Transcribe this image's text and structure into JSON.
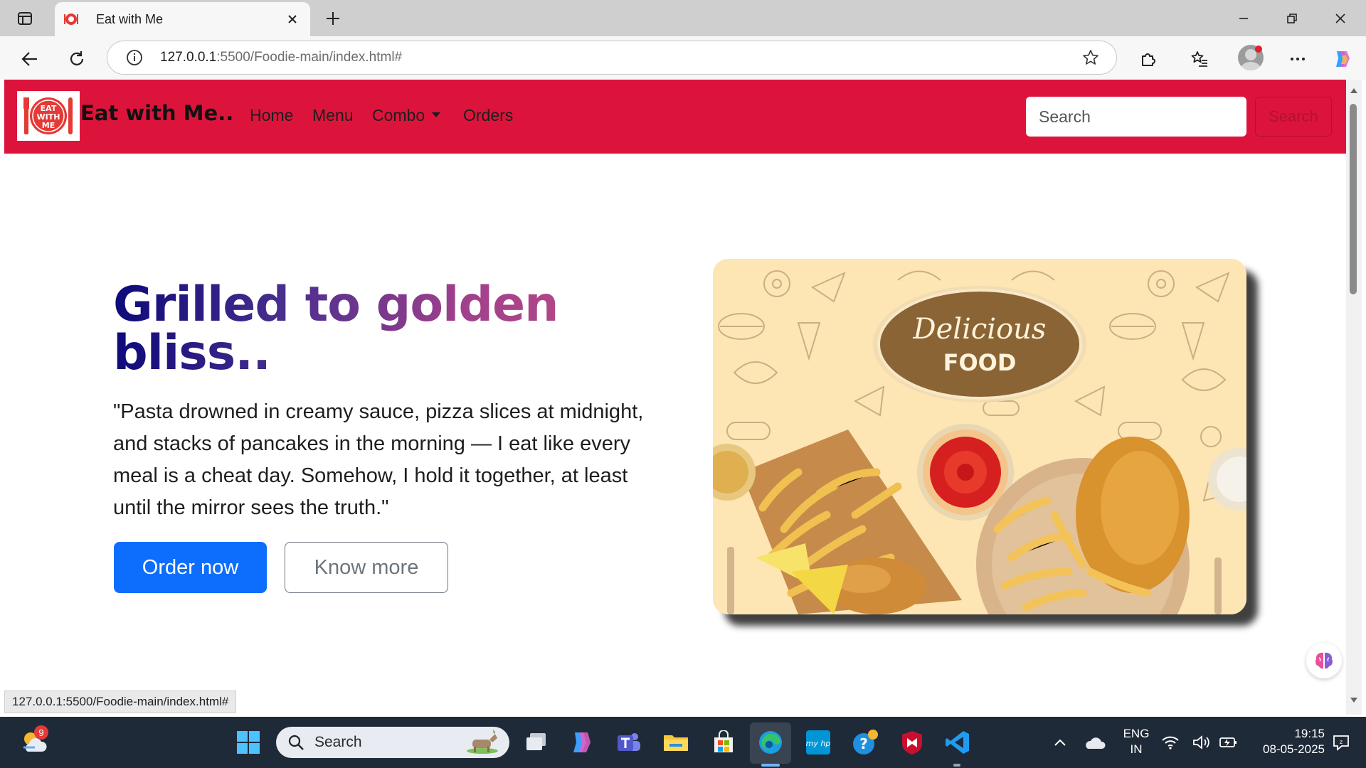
{
  "browser": {
    "tab_title": "Eat with Me",
    "url_host": "127.0.0.1",
    "url_path": ":5500/Foodie-main/index.html#",
    "status_url": "127.0.0.1:5500/Foodie-main/index.html#"
  },
  "navbar": {
    "brand": "Eat with Me..",
    "logo_text": [
      "EAT",
      "WITH",
      "ME"
    ],
    "links": [
      "Home",
      "Menu",
      "Combo",
      "Orders"
    ],
    "search_placeholder": "Search",
    "search_button": "Search",
    "colors": {
      "navbar_bg": "#dc143c",
      "primary": "#0d6efd"
    }
  },
  "hero": {
    "title": "Grilled to golden bliss..",
    "text": "\"Pasta drowned in creamy sauce, pizza slices at midnight, and stacks of pancakes in the morning — I eat like every meal is a cheat day. Somehow, I hold it together, at least until the mirror sees the truth.\"",
    "primary_button": "Order now",
    "secondary_button": "Know more",
    "image_title": "Delicious",
    "image_subtitle": "FOOD"
  },
  "taskbar": {
    "search_label": "Search",
    "weather_badge": "9",
    "language": "ENG",
    "region": "IN",
    "time": "19:15",
    "date": "08-05-2025",
    "icons": [
      "weather-icon",
      "windows-start-icon",
      "task-view-icon",
      "copilot-icon",
      "teams-icon",
      "file-explorer-icon",
      "microsoft-store-icon",
      "edge-icon",
      "myhp-icon",
      "help-icon",
      "mcafee-icon",
      "vscode-icon"
    ]
  }
}
